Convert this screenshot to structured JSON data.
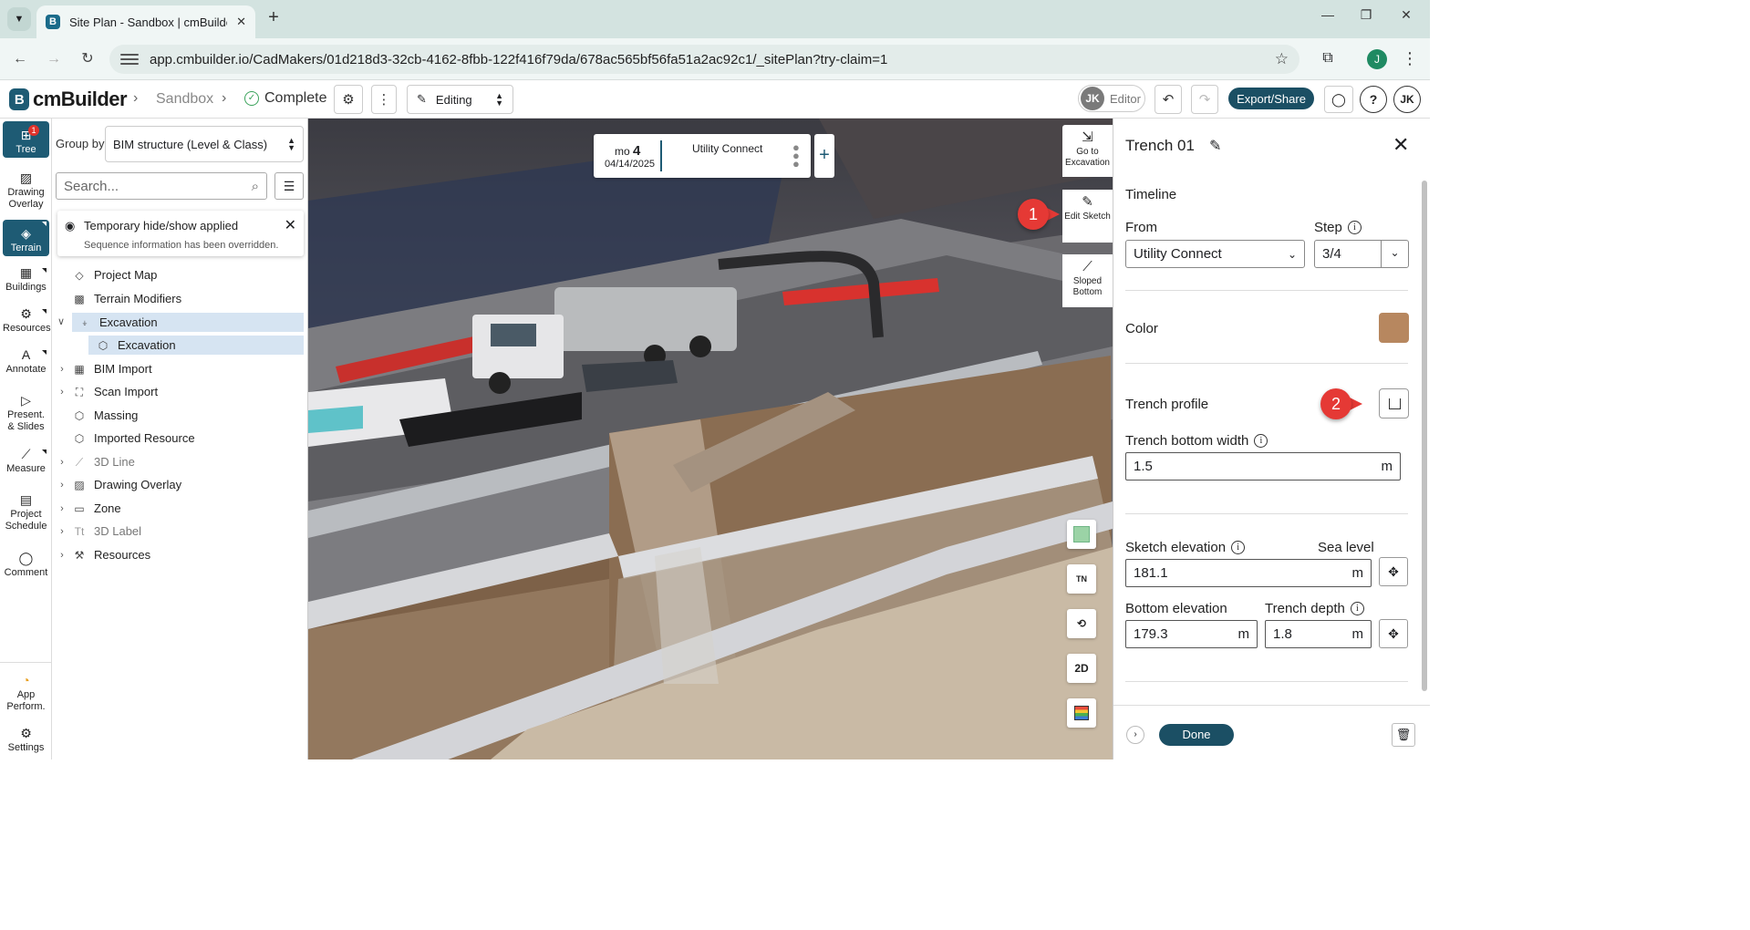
{
  "browser": {
    "tab_title": "Site Plan - Sandbox | cmBuilder",
    "tab_favicon": "B",
    "url": "app.cmbuilder.io/CadMakers/01d218d3-32cb-4162-8fbb-122f416f79da/678ac565bf56fa51a2ac92c1/_sitePlan?try-claim=1",
    "profile_initial": "J"
  },
  "header": {
    "logo_mark": "B",
    "logo_text": "cmBuilder",
    "breadcrumb_project": "Sandbox",
    "breadcrumb_status": "Complete",
    "mode": "Editing",
    "user_initials": "JK",
    "role": "Editor",
    "export_label": "Export/Share",
    "help_label": "?",
    "account_initials": "JK"
  },
  "rail": {
    "items": [
      {
        "label": "Tree",
        "badge": "1"
      },
      {
        "label": "Drawing Overlay"
      },
      {
        "label": "Terrain"
      },
      {
        "label": "Buildings"
      },
      {
        "label": "Resources"
      },
      {
        "label": "Annotate"
      },
      {
        "label": "Present. & Slides"
      },
      {
        "label": "Measure"
      },
      {
        "label": "Project Schedule"
      },
      {
        "label": "Comment"
      },
      {
        "label": "App Perform."
      },
      {
        "label": "Settings"
      }
    ]
  },
  "tree": {
    "group_by_label": "Group by",
    "group_by_value": "BIM structure (Level & Class)",
    "search_placeholder": "Search...",
    "notice_title": "Temporary hide/show applied",
    "notice_sub": "Sequence information has been overridden.",
    "nodes": [
      {
        "label": "Project Map"
      },
      {
        "label": "Terrain Modifiers"
      },
      {
        "label": "Excavation"
      },
      {
        "label": "Excavation"
      },
      {
        "label": "BIM Import"
      },
      {
        "label": "Scan Import"
      },
      {
        "label": "Massing"
      },
      {
        "label": "Imported Resource"
      },
      {
        "label": "3D Line"
      },
      {
        "label": "Drawing Overlay"
      },
      {
        "label": "Zone"
      },
      {
        "label": "3D Label"
      },
      {
        "label": "Resources"
      }
    ]
  },
  "viewport": {
    "seq_unit": "mo",
    "seq_number": "4",
    "seq_date": "04/14/2025",
    "seq_phase": "Utility Connect",
    "tools": {
      "go_to": "Go to Excavation",
      "edit_sketch": "Edit Sketch",
      "sloped_bottom": "Sloped Bottom"
    },
    "north_label": "TN",
    "view_mode": "2D",
    "callouts": [
      "1",
      "2"
    ]
  },
  "props": {
    "title": "Trench 01",
    "timeline_label": "Timeline",
    "from_label": "From",
    "from_value": "Utility Connect",
    "step_label": "Step",
    "step_value": "3/4",
    "color_label": "Color",
    "color_value": "#b7875f",
    "trench_profile_label": "Trench profile",
    "bottom_width_label": "Trench bottom width",
    "bottom_width_value": "1.5",
    "sketch_elev_label": "Sketch elevation",
    "sea_level_label": "Sea level",
    "sketch_elev_value": "181.1",
    "bottom_elev_label": "Bottom elevation",
    "bottom_elev_value": "179.3",
    "depth_label": "Trench depth",
    "depth_value": "1.8",
    "unit": "m",
    "done_label": "Done"
  },
  "colors": {
    "brand": "#1e5b74",
    "callout": "#e53935",
    "selection": "#d6e4f2"
  }
}
